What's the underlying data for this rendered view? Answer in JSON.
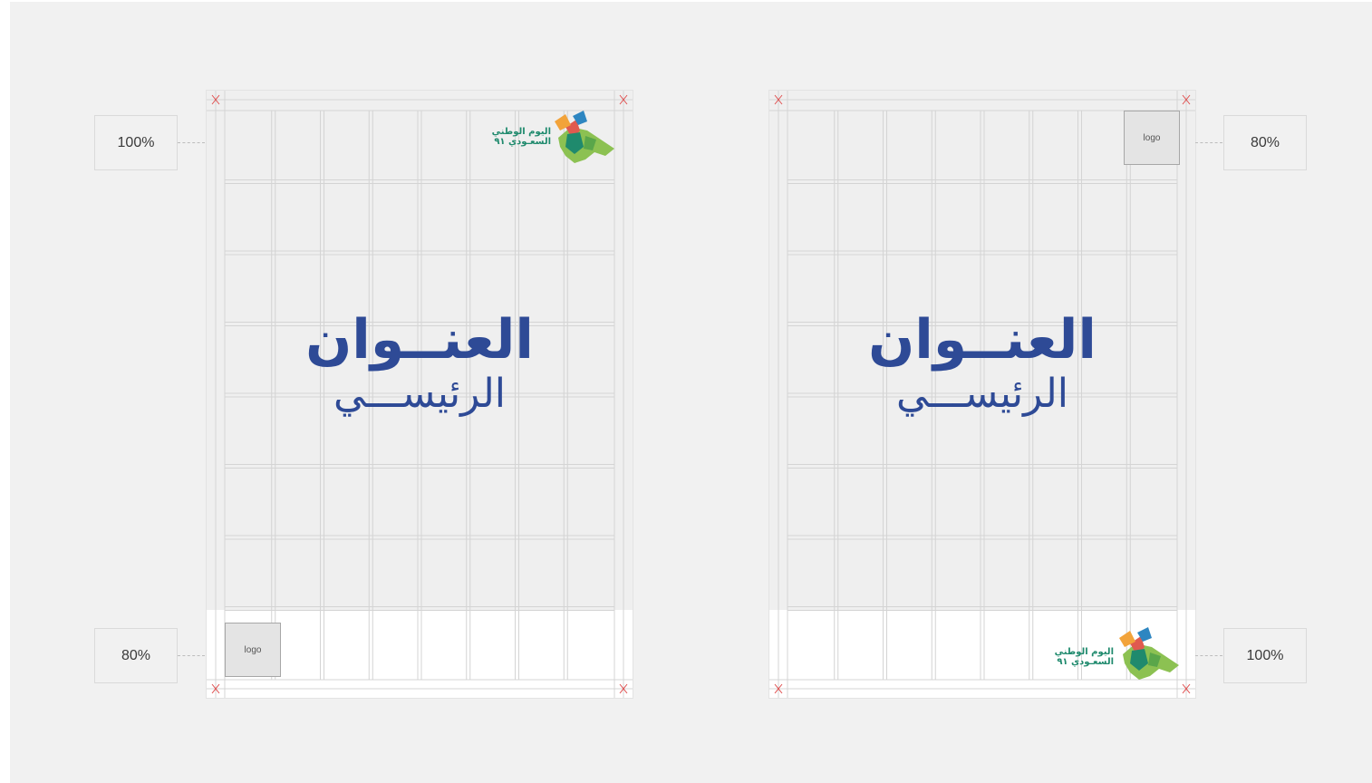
{
  "diagram": {
    "left_poster": {
      "title_line1": "العنــوان",
      "title_line2": "الرئيســـي",
      "top_logo_scale": "100%",
      "bottom_logo_scale": "80%",
      "logo_placeholder": "logo",
      "emblem_text_line1": "اليوم الوطني",
      "emblem_text_line2": "السعـودي ٩١"
    },
    "right_poster": {
      "title_line1": "العنــوان",
      "title_line2": "الرئيســـي",
      "top_logo_scale": "80%",
      "bottom_logo_scale": "100%",
      "logo_placeholder": "logo",
      "emblem_text_line1": "اليوم الوطني",
      "emblem_text_line2": "السعـودي ٩١"
    }
  },
  "colors": {
    "title": "#2e4a96",
    "grid": "#d4d4d4",
    "crop_mark": "#e05050",
    "emblem_green": "#1f8a6d"
  }
}
